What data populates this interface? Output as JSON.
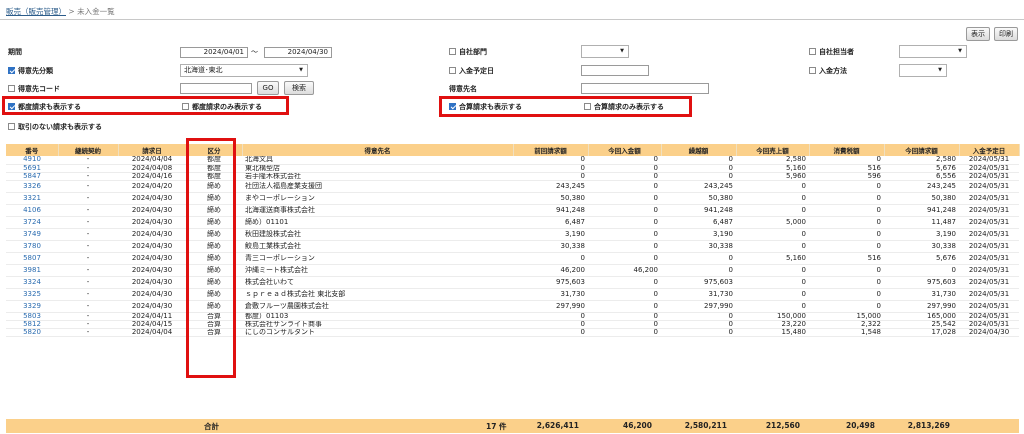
{
  "breadcrumb": {
    "parent": "販売（販売管理）",
    "separator": ">",
    "current": "未入金一覧"
  },
  "toolbar": {
    "show_label": "表示",
    "print_label": "印刷"
  },
  "filters": {
    "period_label": "期間",
    "period_from": "2024/04/01",
    "period_tilde": "〜",
    "period_to": "2024/04/30",
    "customer_class_label": "得意先分類",
    "customer_class_value": "北海道･東北",
    "customer_code_label": "得意先コード",
    "go_label": "GO",
    "search_label": "検索",
    "own_dept_label": "自社部門",
    "deposit_date_label": "入金予定日",
    "customer_name_label": "得意先名",
    "own_staff_label": "自社担当者",
    "deposit_method_label": "入金方法",
    "show_each_label": "都度請求も表示する",
    "each_only_label": "都度請求のみ表示する",
    "show_combined_label": "合算請求も表示する",
    "combined_only_label": "合算請求のみ表示する",
    "no_tx_label": "取引のない請求も表示する"
  },
  "table": {
    "columns": [
      "番号",
      "継続契約",
      "請求日",
      "区分",
      "得意先名",
      "前回請求額",
      "今回入金額",
      "繰越額",
      "今回売上額",
      "消費税額",
      "今回請求額",
      "入金予定日"
    ],
    "rows": [
      [
        "4910",
        "-",
        "2024/04/04",
        "都度",
        "北海文具",
        "0",
        "0",
        "0",
        "2,580",
        "0",
        "2,580",
        "2024/05/31"
      ],
      [
        "5691",
        "-",
        "2024/04/08",
        "都度",
        "東北構型店",
        "0",
        "0",
        "0",
        "5,160",
        "516",
        "5,676",
        "2024/05/31"
      ],
      [
        "5847",
        "-",
        "2024/04/16",
        "都度",
        "岩手隆木株式会社",
        "0",
        "0",
        "0",
        "5,960",
        "596",
        "6,556",
        "2024/05/31"
      ],
      [
        "3326",
        "-",
        "2024/04/20",
        "締め",
        "社団法人福島産業支援団",
        "243,245",
        "0",
        "243,245",
        "0",
        "0",
        "243,245",
        "2024/05/31"
      ],
      [
        "3321",
        "-",
        "2024/04/30",
        "締め",
        "まやコーポレーション",
        "50,380",
        "0",
        "50,380",
        "0",
        "0",
        "50,380",
        "2024/05/31"
      ],
      [
        "4106",
        "-",
        "2024/04/30",
        "締め",
        "北海運送商事株式会社",
        "941,248",
        "0",
        "941,248",
        "0",
        "0",
        "941,248",
        "2024/05/31"
      ],
      [
        "3724",
        "-",
        "2024/04/30",
        "締め",
        "締め）01101",
        "6,487",
        "0",
        "6,487",
        "5,000",
        "0",
        "11,487",
        "2024/05/31"
      ],
      [
        "3749",
        "-",
        "2024/04/30",
        "締め",
        "秋田建設株式会社",
        "3,190",
        "0",
        "3,190",
        "0",
        "0",
        "3,190",
        "2024/05/31"
      ],
      [
        "3780",
        "-",
        "2024/04/30",
        "締め",
        "鮫島工業株式会社",
        "30,338",
        "0",
        "30,338",
        "0",
        "0",
        "30,338",
        "2024/05/31"
      ],
      [
        "5807",
        "-",
        "2024/04/30",
        "締め",
        "青三コーポレーション",
        "0",
        "0",
        "0",
        "5,160",
        "516",
        "5,676",
        "2024/05/31"
      ],
      [
        "3981",
        "-",
        "2024/04/30",
        "締め",
        "沖縄ミート株式会社",
        "46,200",
        "46,200",
        "0",
        "0",
        "0",
        "0",
        "2024/05/31"
      ],
      [
        "3324",
        "-",
        "2024/04/30",
        "締め",
        "株式会社いわて",
        "975,603",
        "0",
        "975,603",
        "0",
        "0",
        "975,603",
        "2024/05/31"
      ],
      [
        "3325",
        "-",
        "2024/04/30",
        "締め",
        "ｓｐｒｅａｄ株式会社 東北支部",
        "31,730",
        "0",
        "31,730",
        "0",
        "0",
        "31,730",
        "2024/05/31"
      ],
      [
        "3329",
        "-",
        "2024/04/30",
        "締め",
        "倉敷フルーツ農園株式会社",
        "297,990",
        "0",
        "297,990",
        "0",
        "0",
        "297,990",
        "2024/05/31"
      ],
      [
        "5803",
        "-",
        "2024/04/11",
        "合算",
        "都度）01103",
        "0",
        "0",
        "0",
        "150,000",
        "15,000",
        "165,000",
        "2024/05/31"
      ],
      [
        "5812",
        "-",
        "2024/04/15",
        "合算",
        "株式会社サンライト商事",
        "0",
        "0",
        "0",
        "23,220",
        "2,322",
        "25,542",
        "2024/05/31"
      ],
      [
        "5820",
        "-",
        "2024/04/04",
        "合算",
        "にしのコンサルタント",
        "0",
        "0",
        "0",
        "15,480",
        "1,548",
        "17,028",
        "2024/04/30"
      ]
    ]
  },
  "totals": {
    "label": "合計",
    "count": "17 件",
    "prev_billing": "2,626,411",
    "deposit": "46,200",
    "carryover": "2,580,211",
    "sales": "212,560",
    "tax": "20,498",
    "billing": "2,813,269"
  },
  "colors": {
    "header": "#fbd08a",
    "highlight": "#e01010",
    "link": "#2b6cb0",
    "checkbox_on": "#2f72c4"
  },
  "state": {
    "show_each_checked": true,
    "each_only_checked": false,
    "show_combined_checked": true,
    "combined_only_checked": false,
    "customer_class_checked": true,
    "no_tx_checked": false
  }
}
